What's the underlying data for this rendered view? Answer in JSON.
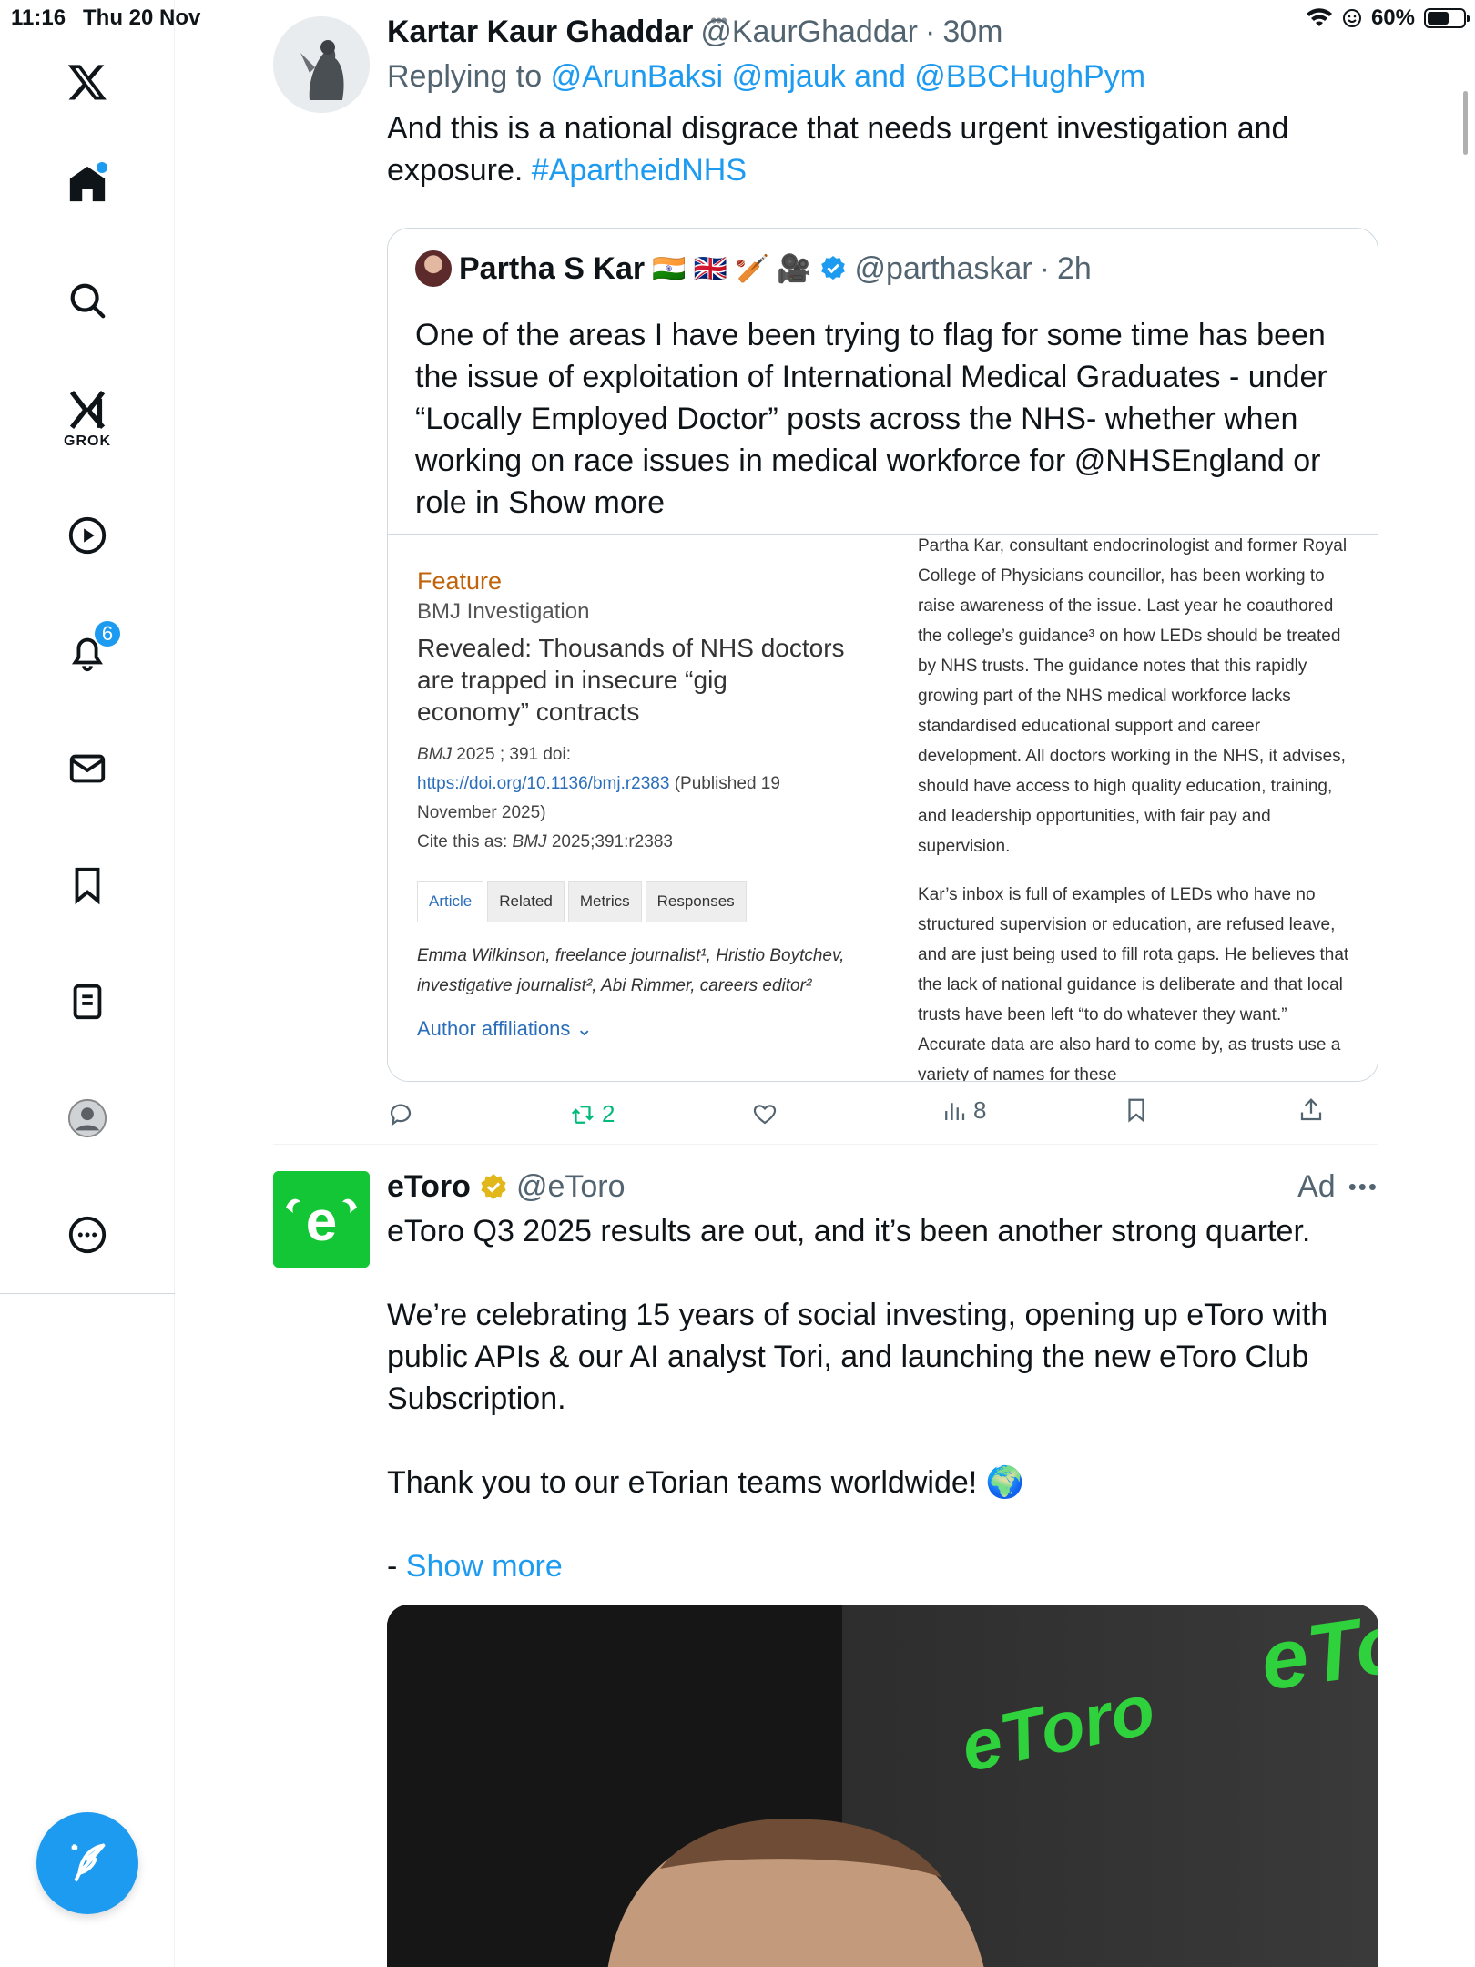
{
  "status": {
    "time": "11:16",
    "date": "Thu 20 Nov",
    "battery": "60%",
    "battery_level": 0.6
  },
  "sidebar": {
    "items": [
      {
        "name": "x-logo-icon"
      },
      {
        "name": "home-icon",
        "has_dot": true
      },
      {
        "name": "search-icon"
      },
      {
        "name": "grok-icon",
        "label": "GROK"
      },
      {
        "name": "video-icon"
      },
      {
        "name": "notifications-icon",
        "badge": "6"
      },
      {
        "name": "messages-icon"
      },
      {
        "name": "bookmarks-icon"
      },
      {
        "name": "lists-icon"
      },
      {
        "name": "profile-icon"
      },
      {
        "name": "more-icon"
      }
    ],
    "compose_icon": "compose-icon"
  },
  "tweet1": {
    "display_name": "Kartar Kaur Ghaddar",
    "handle": "@KaurGhaddar",
    "separator": "·",
    "time": "30m",
    "reply_prefix": "Replying to",
    "reply_targets": "@ArunBaksi @mjauk and @BBCHughPym",
    "text": "And this is a national disgrace that needs urgent investigation and exposure.",
    "hashtag": "#ApartheidNHS",
    "quote": {
      "display_name": "Partha S Kar",
      "emojis": "🇮🇳 🇬🇧 🏏 🎥",
      "handle": "@parthaskar",
      "time": "2h",
      "text": "One of the areas I have been trying to flag for some time has been the issue of exploitation of International Medical Graduates - under “Locally Employed Doctor” posts across the NHS- whether when working on race issues in medical workforce for @NHSEngland or role in",
      "show_more": "Show more",
      "article": {
        "feature": "Feature",
        "section": "BMJ Investigation",
        "headline": "Revealed: Thousands of NHS doctors are trapped in insecure “gig economy” contracts",
        "cite_journal": "BMJ",
        "cite_vol": " 2025 ; 391  doi:",
        "doi": "https://doi.org/10.1136/bmj.r2383",
        "published": " (Published 19 November 2025)",
        "cite_as_prefix": "Cite this as: ",
        "cite_as_journal": "BMJ",
        "cite_as_rest": " 2025;391:r2383",
        "tabs": [
          "Article",
          "Related",
          "Metrics",
          "Responses"
        ],
        "authors": "Emma Wilkinson, freelance journalist¹, Hristio Boytchev, investigative journalist², Abi Rimmer, careers editor²",
        "affiliations": "Author affiliations ⌄",
        "body_p1": "Partha Kar, consultant endocrinologist and former Royal College of Physicians councillor, has been working to raise awareness of the issue. Last year he coauthored the college’s guidance³  on how LEDs should be treated by NHS trusts. The guidance notes that this rapidly growing part of the NHS medical workforce lacks standardised educational support and career development. All doctors working in the NHS, it advises, should have access to high quality education, training, and leadership opportunities, with fair pay and supervision.",
        "body_p2": "Kar’s inbox is full of examples of LEDs who have no structured supervision or education, are refused leave, and are just being used to fill rota gaps. He believes that the lack of national guidance is deliberate and that local trusts have been left “to do whatever they want.” Accurate data are also hard to come by, as trusts use a variety of names for these"
      }
    },
    "actions": {
      "reply_count": "",
      "retweet_count": "2",
      "like_count": "",
      "views_count": "8"
    }
  },
  "tweet2": {
    "display_name": "eToro",
    "handle": "@eToro",
    "ad_label": "Ad",
    "line1": "eToro Q3 2025 results are out, and it’s been another strong quarter.",
    "line2": "We’re celebrating 15 years of social investing, opening up eToro with public APIs & our AI analyst Tori, and launching the new eToro Club Subscription.",
    "line3": "Thank you to our eTorian teams worldwide! 🌍",
    "show_more_prefix": "- ",
    "show_more": "Show more",
    "video_brand_1": "eToro",
    "video_brand_2": "eTo"
  },
  "colors": {
    "accent": "#1d9bf0",
    "retweet_green": "#00ba7c",
    "etoro_green": "#13c636",
    "bmj_orange": "#c0630b"
  }
}
